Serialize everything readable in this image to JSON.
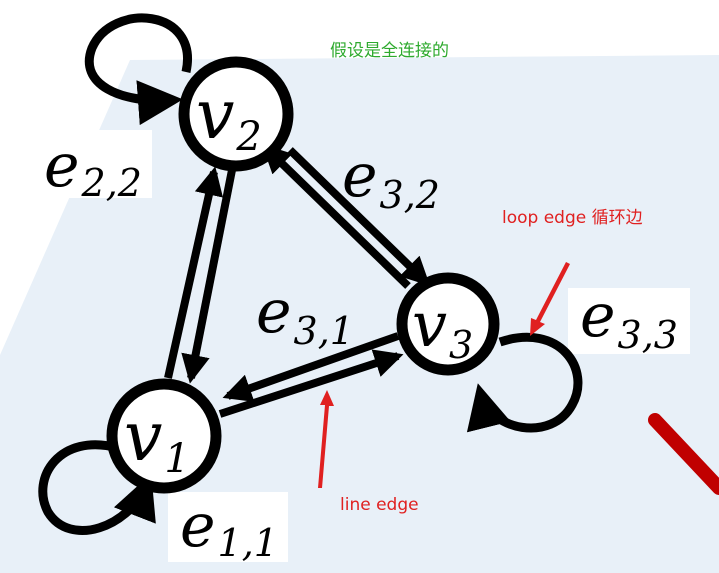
{
  "annotations": {
    "top_note": "假设是全连接的",
    "loop_edge_note": "loop edge 循环边",
    "line_edge_note": "line edge"
  },
  "nodes": {
    "v1": {
      "base": "v",
      "sub": "1"
    },
    "v2": {
      "base": "v",
      "sub": "2"
    },
    "v3": {
      "base": "v",
      "sub": "3"
    }
  },
  "edges": {
    "e11": {
      "base": "e",
      "sub": "1,1"
    },
    "e22": {
      "base": "e",
      "sub": "2,2"
    },
    "e31": {
      "base": "e",
      "sub": "3,1"
    },
    "e32": {
      "base": "e",
      "sub": "3,2"
    },
    "e33": {
      "base": "e",
      "sub": "3,3"
    }
  },
  "colors": {
    "background_panel": "#e8f0f8",
    "node_stroke": "#000000",
    "top_note": "#2eaa2e",
    "red_notes": "#e02020",
    "red_bar": "#c00000"
  }
}
